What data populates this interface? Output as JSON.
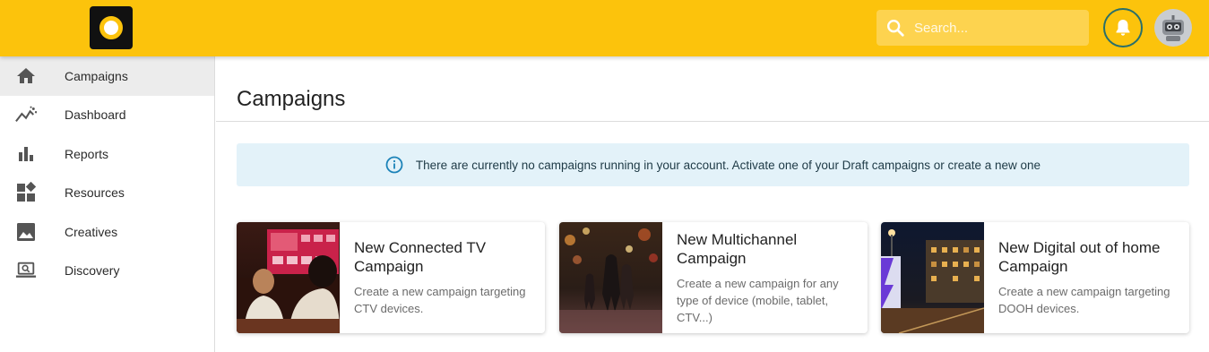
{
  "header": {
    "search_placeholder": "Search...",
    "brand_color": "#fcc30c"
  },
  "sidebar": {
    "items": [
      {
        "label": "Campaigns",
        "icon": "home-icon",
        "active": true
      },
      {
        "label": "Dashboard",
        "icon": "trend-icon"
      },
      {
        "label": "Reports",
        "icon": "bar-chart-icon"
      },
      {
        "label": "Resources",
        "icon": "widgets-icon"
      },
      {
        "label": "Creatives",
        "icon": "image-icon"
      },
      {
        "label": "Discovery",
        "icon": "laptop-search-icon"
      }
    ]
  },
  "main": {
    "title": "Campaigns",
    "banner": "There are currently no campaigns running in your account. Activate one of your Draft campaigns or create a new one",
    "cards": [
      {
        "title": "New Connected TV Campaign",
        "description": "Create a new campaign targeting CTV devices."
      },
      {
        "title": "New Multichannel Campaign",
        "description": "Create a new campaign for any type of device (mobile, tablet, CTV...)"
      },
      {
        "title": "New Digital out of home Campaign",
        "description": "Create a new campaign targeting DOOH devices."
      }
    ]
  }
}
